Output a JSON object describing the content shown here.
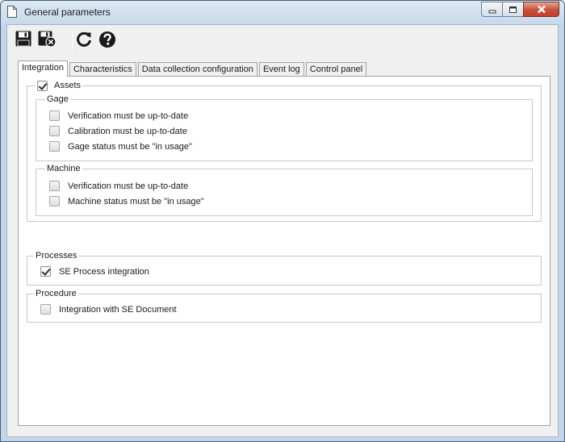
{
  "window": {
    "title": "General parameters",
    "close_color": "#c8503a"
  },
  "toolbar": {
    "save": "save-icon",
    "save_close": "save-close-icon",
    "refresh": "refresh-icon",
    "help": "help-icon"
  },
  "tabs": [
    {
      "label": "Integration",
      "active": true
    },
    {
      "label": "Characteristics",
      "active": false
    },
    {
      "label": "Data collection configuration",
      "active": false
    },
    {
      "label": "Event log",
      "active": false
    },
    {
      "label": "Control panel",
      "active": false
    }
  ],
  "assets": {
    "label": "Assets",
    "checked": true,
    "gage": {
      "label": "Gage",
      "options": [
        {
          "label": "Verification must be up-to-date",
          "checked": false
        },
        {
          "label": "Calibration must be up-to-date",
          "checked": false
        },
        {
          "label": "Gage status must be \"in usage\"",
          "checked": false
        }
      ]
    },
    "machine": {
      "label": "Machine",
      "options": [
        {
          "label": "Verification must be up-to-date",
          "checked": false
        },
        {
          "label": "Machine status must be \"in usage\"",
          "checked": false
        }
      ]
    }
  },
  "processes": {
    "label": "Processes",
    "options": [
      {
        "label": "SE Process integration",
        "checked": true
      }
    ]
  },
  "procedure": {
    "label": "Procedure",
    "options": [
      {
        "label": "Integration with SE Document",
        "checked": false
      }
    ]
  }
}
